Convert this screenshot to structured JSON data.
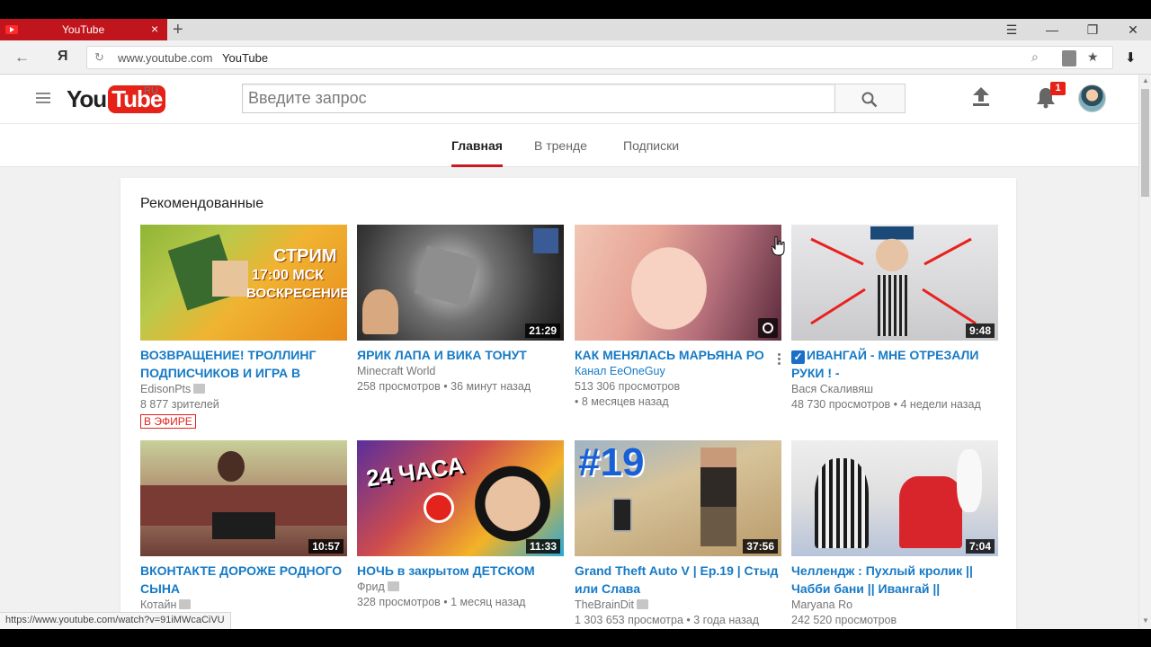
{
  "browser": {
    "tab_title": "YouTube",
    "tab_close": "×",
    "new_tab": "+",
    "window_controls": [
      "☰",
      "—",
      "❐",
      "✕"
    ],
    "back": "←",
    "yandex_button": "Я",
    "reload": "↻",
    "url_host": "www.youtube.com",
    "url_page_title": "YouTube",
    "download": "⬇",
    "status_url": "https://www.youtube.com/watch?v=91iMWcaCiVU"
  },
  "masthead": {
    "logo_you": "You",
    "logo_tube": "Tube",
    "logo_region": "RU",
    "search_placeholder": "Введите запрос",
    "notification_count": "1"
  },
  "nav_tabs": [
    {
      "label": "Главная",
      "active": true
    },
    {
      "label": "В тренде",
      "active": false
    },
    {
      "label": "Подписки",
      "active": false
    }
  ],
  "section": {
    "title": "Рекомендованные"
  },
  "videos": [
    {
      "title": "ВОЗВРАЩЕНИЕ! ТРОЛЛИНГ ПОДПИСЧИКОВ И ИГРА В",
      "channel": "EdisonPts",
      "verified": true,
      "line2": "8 877 зрителей",
      "live_badge": "В ЭФИРЕ",
      "thumb_text": [
        "СТРИМ",
        "17:00 МСК",
        "ВОСКРЕСЕНИЕ"
      ],
      "duration": ""
    },
    {
      "title": "ЯРИК ЛАПА И ВИКА ТОНУТ",
      "channel": "Minecraft World",
      "verified": false,
      "views": "258 просмотров",
      "age": "36 минут назад",
      "duration": "21:29"
    },
    {
      "title": "КАК МЕНЯЛАСЬ МАРЬЯНА РО",
      "channel": "Канал EeOneGuy",
      "verified": false,
      "views": "513 306 просмотров",
      "age": "8 месяцев назад",
      "duration": ""
    },
    {
      "title": "ИВАНГАЙ - МНЕ ОТРЕЗАЛИ РУКИ ! -",
      "title_prefix_icon": "✓",
      "channel": "Вася Скаливяш",
      "verified": false,
      "views": "48 730 просмотров",
      "age": "4 недели назад",
      "duration": "9:48"
    },
    {
      "title": "ВКОНТАКТЕ ДОРОЖЕ РОДНОГО СЫНА",
      "channel": "Котайн",
      "verified": true,
      "duration": "10:57"
    },
    {
      "title": "НОЧЬ в закрытом ДЕТСКОМ",
      "channel": "Фрид",
      "verified": true,
      "views": "328 просмотров",
      "age": "1 месяц назад",
      "duration": "11:33",
      "thumb_text": [
        "24 ЧАСА"
      ]
    },
    {
      "title": "Grand Theft Auto V | Ep.19 | Стыд или Слава",
      "channel": "TheBrainDit",
      "verified": true,
      "views": "1 303 653 просмотра",
      "age": "3 года назад",
      "duration": "37:56",
      "thumb_text": [
        "#19"
      ]
    },
    {
      "title": "Челлендж : Пухлый кролик || Чабби бани || Ивангай ||",
      "channel": "Maryana Ro",
      "verified": false,
      "views": "242 520 просмотров",
      "duration": "7:04"
    }
  ],
  "colors": {
    "brand_red": "#e62117",
    "link_blue": "#167ac6",
    "tab_red": "#c0151c"
  }
}
